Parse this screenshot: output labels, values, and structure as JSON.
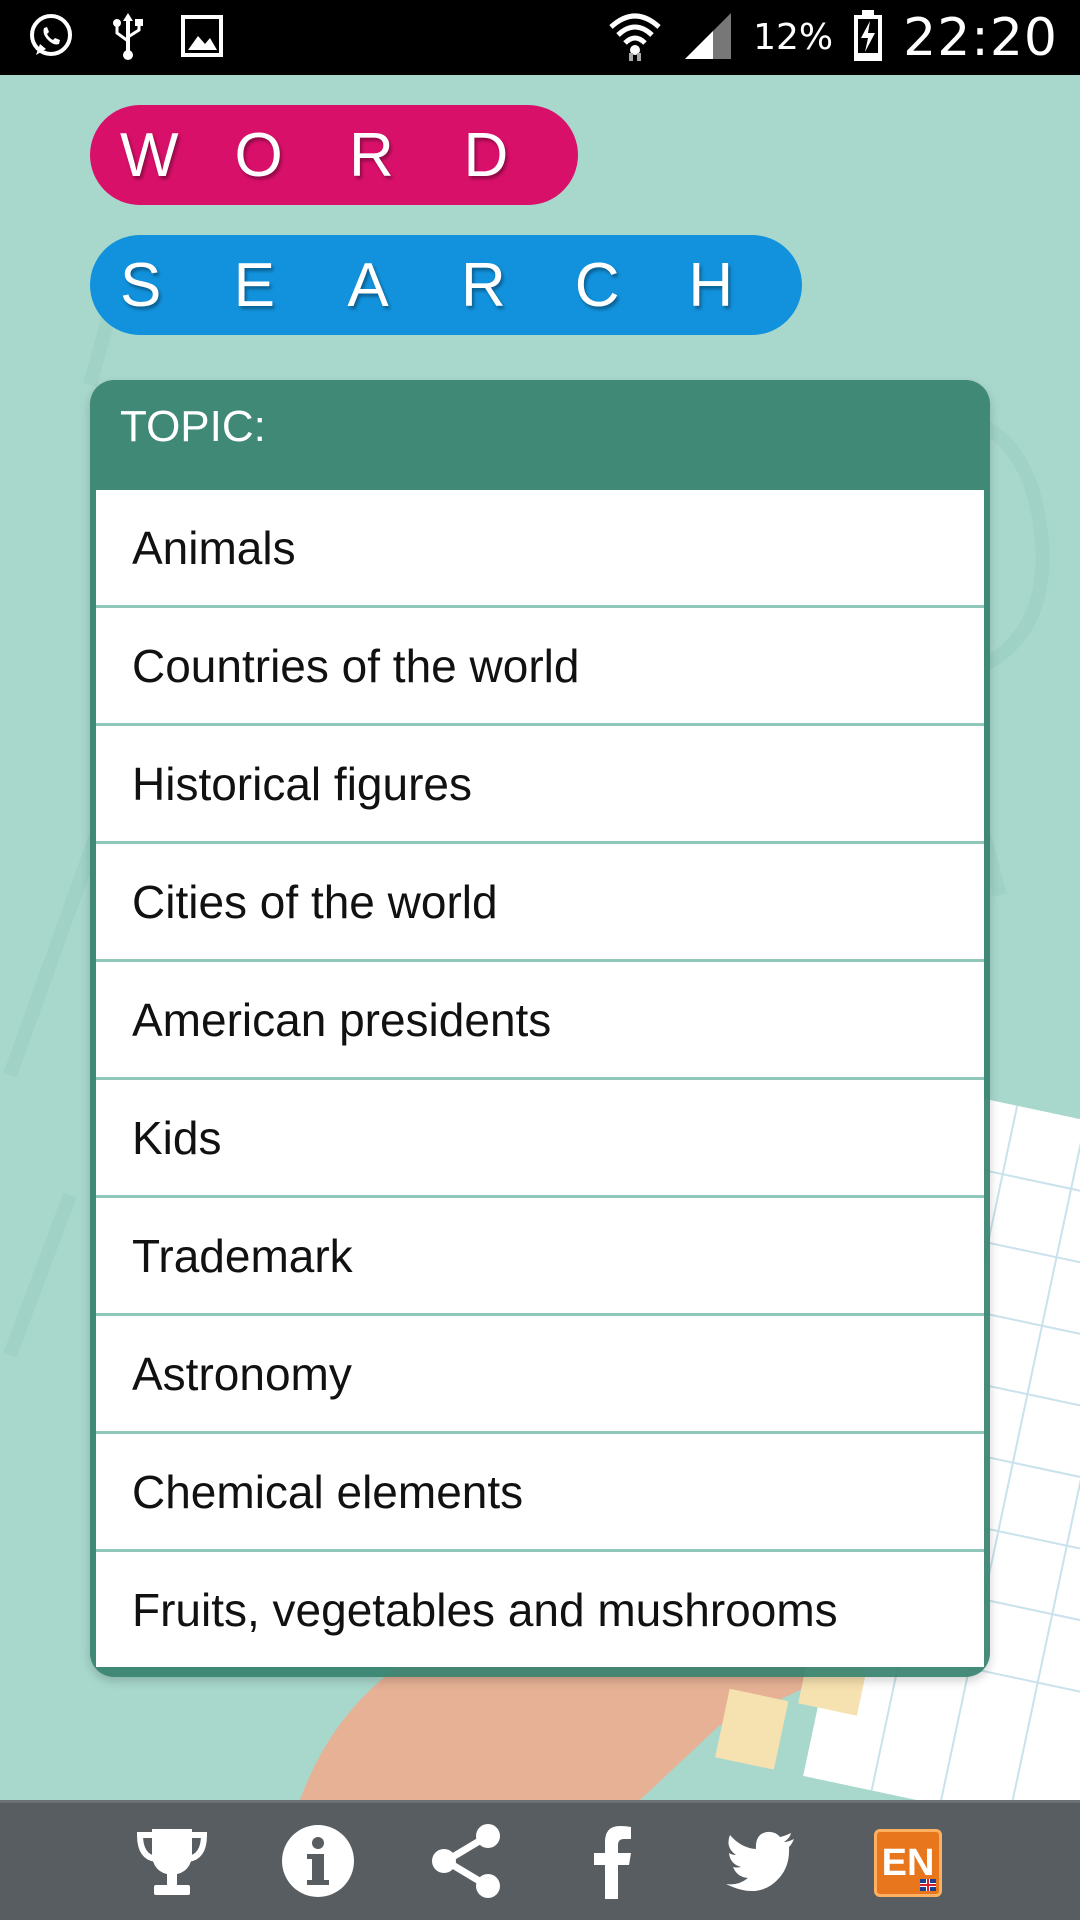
{
  "status_bar": {
    "left_icons": [
      "whatsapp-icon",
      "usb-icon",
      "image-icon"
    ],
    "right_icons": [
      "wifi-icon",
      "signal-icon",
      "battery-charging-icon"
    ],
    "battery_percent": "12%",
    "time": "22:20"
  },
  "title": {
    "word_letters": [
      "W",
      "O",
      "R",
      "D"
    ],
    "search_letters": [
      "S",
      "E",
      "A",
      "R",
      "C",
      "H"
    ],
    "word_color": "#d9106a",
    "search_color": "#1292dc"
  },
  "topic_panel": {
    "header": "TOPIC:",
    "items": [
      "Animals",
      "Countries of the world",
      "Historical figures",
      "Cities of the world",
      "American presidents",
      "Kids",
      "Trademark",
      "Astronomy",
      "Chemical elements",
      "Fruits, vegetables and mushrooms"
    ]
  },
  "bottom_bar": {
    "icons": [
      "trophy-icon",
      "info-icon",
      "share-icon",
      "facebook-icon",
      "twitter-icon",
      "language-icon"
    ],
    "language_label": "EN"
  },
  "colors": {
    "background": "#a8d8cc",
    "panel": "#378270",
    "bottom_bar": "#575d61"
  }
}
